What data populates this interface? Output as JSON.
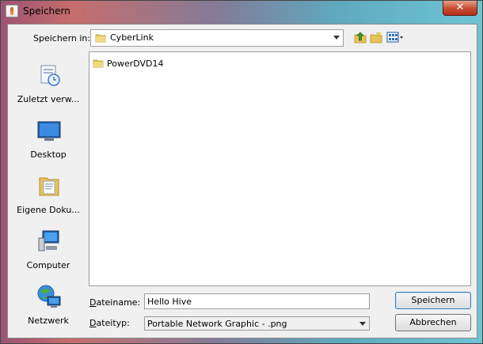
{
  "window": {
    "title": "Speichern"
  },
  "icons": {
    "close": "close-icon",
    "app": "java-icon"
  },
  "save_in": {
    "label": "Speichern in:",
    "value": "CyberLink"
  },
  "toolbar": {
    "up": "up-folder-icon",
    "new_folder": "new-folder-icon",
    "view": "view-menu-icon"
  },
  "places": [
    {
      "label": "Zuletzt verw...",
      "icon": "recent-icon"
    },
    {
      "label": "Desktop",
      "icon": "desktop-icon"
    },
    {
      "label": "Eigene Doku...",
      "icon": "documents-icon"
    },
    {
      "label": "Computer",
      "icon": "computer-icon"
    },
    {
      "label": "Netzwerk",
      "icon": "network-icon"
    }
  ],
  "files": [
    {
      "name": "PowerDVD14",
      "type": "folder"
    }
  ],
  "filename": {
    "label": "Dateiname:",
    "value": "Hello Hive"
  },
  "filetype": {
    "label": "Dateityp:",
    "value": "Portable Network Graphic - .png"
  },
  "buttons": {
    "save": "Speichern",
    "cancel": "Abbrechen"
  },
  "colors": {
    "folder": "#e8c35a",
    "accent": "#3c7fb1",
    "close": "#c84a2f"
  }
}
